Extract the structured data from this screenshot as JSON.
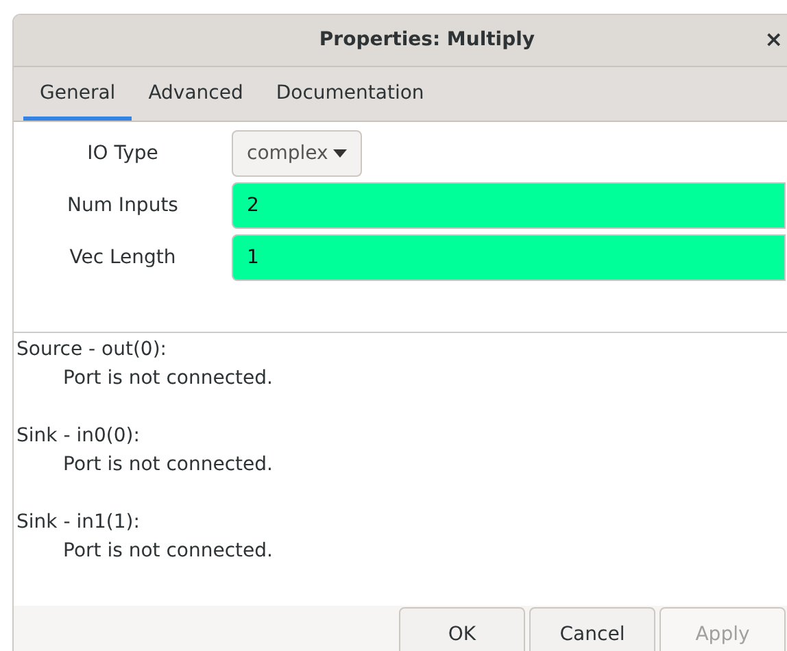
{
  "window": {
    "title": "Properties: Multiply",
    "close": "×"
  },
  "tabs": [
    {
      "label": "General",
      "selected": true
    },
    {
      "label": "Advanced",
      "selected": false
    },
    {
      "label": "Documentation",
      "selected": false
    }
  ],
  "params": [
    {
      "kind": "dropdown",
      "label": "IO Type",
      "value": "complex"
    },
    {
      "kind": "entry",
      "label": "Num Inputs",
      "value": "2"
    },
    {
      "kind": "entry",
      "label": "Vec Length",
      "value": "1"
    }
  ],
  "ports": [
    {
      "heading": "Source - out(0):",
      "message": "Port is not connected."
    },
    {
      "heading": "Sink - in0(0):",
      "message": "Port is not connected."
    },
    {
      "heading": "Sink - in1(1):",
      "message": "Port is not connected."
    }
  ],
  "buttons": [
    {
      "label": "OK",
      "disabled": false
    },
    {
      "label": "Cancel",
      "disabled": false
    },
    {
      "label": "Apply",
      "disabled": true
    }
  ]
}
